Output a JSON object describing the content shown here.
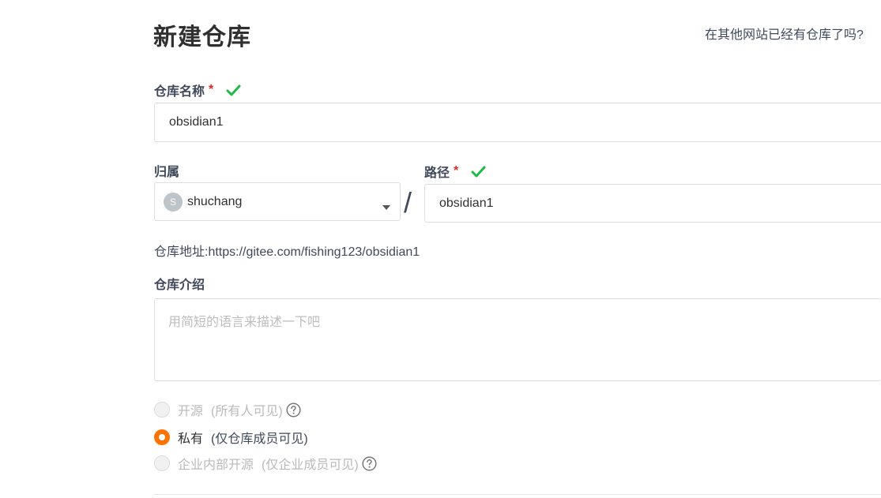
{
  "header": {
    "title": "新建仓库",
    "import_link": "在其他网站已经有仓库了吗?"
  },
  "form": {
    "name": {
      "label": "仓库名称",
      "required_mark": "*",
      "value": "obsidian1",
      "valid": true
    },
    "owner": {
      "label": "归属",
      "avatar_initial": "S",
      "value": "shuchang"
    },
    "separator": "/",
    "path": {
      "label": "路径",
      "required_mark": "*",
      "value": "obsidian1",
      "valid": true
    },
    "address": {
      "label": "仓库地址:",
      "url": "https://gitee.com/fishing123/obsidian1"
    },
    "description": {
      "label": "仓库介绍",
      "placeholder": "用简短的语言来描述一下吧",
      "value": ""
    },
    "visibility": {
      "options": [
        {
          "label": "开源",
          "hint": "(所有人可见)",
          "selected": false,
          "disabled": true,
          "has_help": true
        },
        {
          "label": "私有",
          "hint": "(仅仓库成员可见)",
          "selected": true,
          "disabled": false,
          "has_help": false
        },
        {
          "label": "企业内部开源",
          "hint": "(仅企业成员可见)",
          "selected": false,
          "disabled": true,
          "has_help": true
        }
      ]
    }
  },
  "colors": {
    "accent": "#fe7300",
    "success": "#21ba45",
    "required": "#db2828",
    "disabled_text": "#b9b9b9"
  },
  "icons": {
    "valid": "check-icon",
    "dropdown": "caret-down-icon",
    "help": "question-circle-icon"
  }
}
